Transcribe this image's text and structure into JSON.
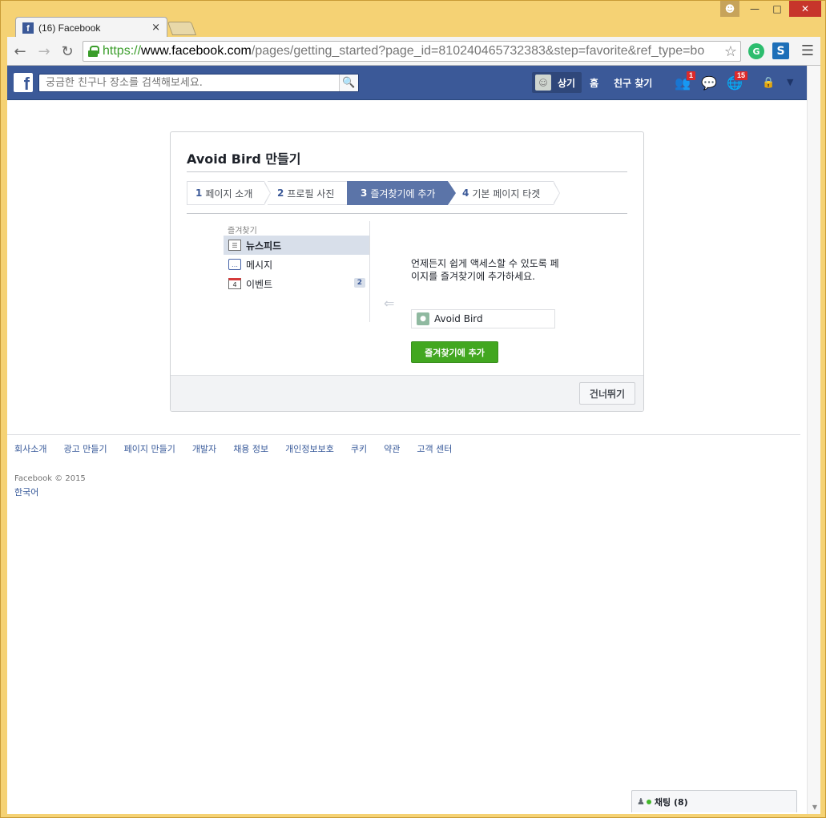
{
  "browser": {
    "tab_title": "(16) Facebook",
    "tab_close": "×",
    "url_scheme": "https://",
    "url_host": "www.facebook.com",
    "url_path": "/pages/getting_started?page_id=810240465732383&step=favorite&ref_type=bo",
    "window_controls": {
      "minimize": "—",
      "maximize": "□",
      "close": "✕"
    },
    "ext1": "G",
    "ext2": "S"
  },
  "fbbar": {
    "logo": "f",
    "search_placeholder": "궁금한 친구나 장소를 검색해보세요.",
    "profile_name": "상기",
    "home": "홈",
    "find_friends": "친구 찾기",
    "friend_requests_badge": "1",
    "notifications_badge": "15"
  },
  "wizard": {
    "title": "Avoid Bird 만들기",
    "steps": [
      {
        "num": "1",
        "label": "페이지 소개"
      },
      {
        "num": "2",
        "label": "프로필 사진"
      },
      {
        "num": "3",
        "label": "즐겨찾기에 추가"
      },
      {
        "num": "4",
        "label": "기본 페이지 타겟"
      }
    ],
    "favorites_heading": "즐겨찾기",
    "favorites": [
      {
        "label": "뉴스피드",
        "icon": "news-feed-icon"
      },
      {
        "label": "메시지",
        "icon": "messages-icon"
      },
      {
        "label": "이벤트",
        "icon": "events-icon",
        "count": "2"
      }
    ],
    "description": "언제든지 쉽게 액세스할 수 있도록 페이지를 즐겨찾기에 추가하세요.",
    "page_name": "Avoid Bird",
    "add_button": "즐겨찾기에 추가",
    "skip_button": "건너뛰기"
  },
  "footer": {
    "links": [
      "회사소개",
      "광고 만들기",
      "페이지 만들기",
      "개발자",
      "채용 정보",
      "개인정보보호",
      "쿠키",
      "약관",
      "고객 센터"
    ],
    "copyright": "Facebook © 2015",
    "language": "한국어"
  },
  "chat": {
    "label": "채팅 (8)"
  },
  "colors": {
    "fb_blue": "#3b5998",
    "active_step": "#5b74a8",
    "green_button": "#42a720",
    "window_frame": "#f5d274"
  }
}
